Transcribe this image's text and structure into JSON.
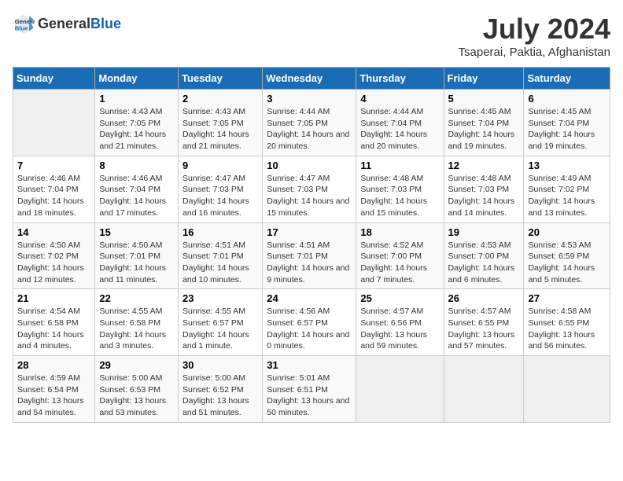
{
  "header": {
    "logo_general": "General",
    "logo_blue": "Blue",
    "title": "July 2024",
    "subtitle": "Tsaperai, Paktia, Afghanistan"
  },
  "weekdays": [
    "Sunday",
    "Monday",
    "Tuesday",
    "Wednesday",
    "Thursday",
    "Friday",
    "Saturday"
  ],
  "weeks": [
    [
      {
        "day": "",
        "empty": true
      },
      {
        "day": "1",
        "sunrise": "4:43 AM",
        "sunset": "7:05 PM",
        "daylight": "14 hours and 21 minutes."
      },
      {
        "day": "2",
        "sunrise": "4:43 AM",
        "sunset": "7:05 PM",
        "daylight": "14 hours and 21 minutes."
      },
      {
        "day": "3",
        "sunrise": "4:44 AM",
        "sunset": "7:05 PM",
        "daylight": "14 hours and 20 minutes."
      },
      {
        "day": "4",
        "sunrise": "4:44 AM",
        "sunset": "7:04 PM",
        "daylight": "14 hours and 20 minutes."
      },
      {
        "day": "5",
        "sunrise": "4:45 AM",
        "sunset": "7:04 PM",
        "daylight": "14 hours and 19 minutes."
      },
      {
        "day": "6",
        "sunrise": "4:45 AM",
        "sunset": "7:04 PM",
        "daylight": "14 hours and 19 minutes."
      }
    ],
    [
      {
        "day": "7",
        "sunrise": "4:46 AM",
        "sunset": "7:04 PM",
        "daylight": "14 hours and 18 minutes."
      },
      {
        "day": "8",
        "sunrise": "4:46 AM",
        "sunset": "7:04 PM",
        "daylight": "14 hours and 17 minutes."
      },
      {
        "day": "9",
        "sunrise": "4:47 AM",
        "sunset": "7:03 PM",
        "daylight": "14 hours and 16 minutes."
      },
      {
        "day": "10",
        "sunrise": "4:47 AM",
        "sunset": "7:03 PM",
        "daylight": "14 hours and 15 minutes."
      },
      {
        "day": "11",
        "sunrise": "4:48 AM",
        "sunset": "7:03 PM",
        "daylight": "14 hours and 15 minutes."
      },
      {
        "day": "12",
        "sunrise": "4:48 AM",
        "sunset": "7:03 PM",
        "daylight": "14 hours and 14 minutes."
      },
      {
        "day": "13",
        "sunrise": "4:49 AM",
        "sunset": "7:02 PM",
        "daylight": "14 hours and 13 minutes."
      }
    ],
    [
      {
        "day": "14",
        "sunrise": "4:50 AM",
        "sunset": "7:02 PM",
        "daylight": "14 hours and 12 minutes."
      },
      {
        "day": "15",
        "sunrise": "4:50 AM",
        "sunset": "7:01 PM",
        "daylight": "14 hours and 11 minutes."
      },
      {
        "day": "16",
        "sunrise": "4:51 AM",
        "sunset": "7:01 PM",
        "daylight": "14 hours and 10 minutes."
      },
      {
        "day": "17",
        "sunrise": "4:51 AM",
        "sunset": "7:01 PM",
        "daylight": "14 hours and 9 minutes."
      },
      {
        "day": "18",
        "sunrise": "4:52 AM",
        "sunset": "7:00 PM",
        "daylight": "14 hours and 7 minutes."
      },
      {
        "day": "19",
        "sunrise": "4:53 AM",
        "sunset": "7:00 PM",
        "daylight": "14 hours and 6 minutes."
      },
      {
        "day": "20",
        "sunrise": "4:53 AM",
        "sunset": "6:59 PM",
        "daylight": "14 hours and 5 minutes."
      }
    ],
    [
      {
        "day": "21",
        "sunrise": "4:54 AM",
        "sunset": "6:58 PM",
        "daylight": "14 hours and 4 minutes."
      },
      {
        "day": "22",
        "sunrise": "4:55 AM",
        "sunset": "6:58 PM",
        "daylight": "14 hours and 3 minutes."
      },
      {
        "day": "23",
        "sunrise": "4:55 AM",
        "sunset": "6:57 PM",
        "daylight": "14 hours and 1 minute."
      },
      {
        "day": "24",
        "sunrise": "4:56 AM",
        "sunset": "6:57 PM",
        "daylight": "14 hours and 0 minutes."
      },
      {
        "day": "25",
        "sunrise": "4:57 AM",
        "sunset": "6:56 PM",
        "daylight": "13 hours and 59 minutes."
      },
      {
        "day": "26",
        "sunrise": "4:57 AM",
        "sunset": "6:55 PM",
        "daylight": "13 hours and 57 minutes."
      },
      {
        "day": "27",
        "sunrise": "4:58 AM",
        "sunset": "6:55 PM",
        "daylight": "13 hours and 56 minutes."
      }
    ],
    [
      {
        "day": "28",
        "sunrise": "4:59 AM",
        "sunset": "6:54 PM",
        "daylight": "13 hours and 54 minutes."
      },
      {
        "day": "29",
        "sunrise": "5:00 AM",
        "sunset": "6:53 PM",
        "daylight": "13 hours and 53 minutes."
      },
      {
        "day": "30",
        "sunrise": "5:00 AM",
        "sunset": "6:52 PM",
        "daylight": "13 hours and 51 minutes."
      },
      {
        "day": "31",
        "sunrise": "5:01 AM",
        "sunset": "6:51 PM",
        "daylight": "13 hours and 50 minutes."
      },
      {
        "day": "",
        "empty": true
      },
      {
        "day": "",
        "empty": true
      },
      {
        "day": "",
        "empty": true
      }
    ]
  ]
}
